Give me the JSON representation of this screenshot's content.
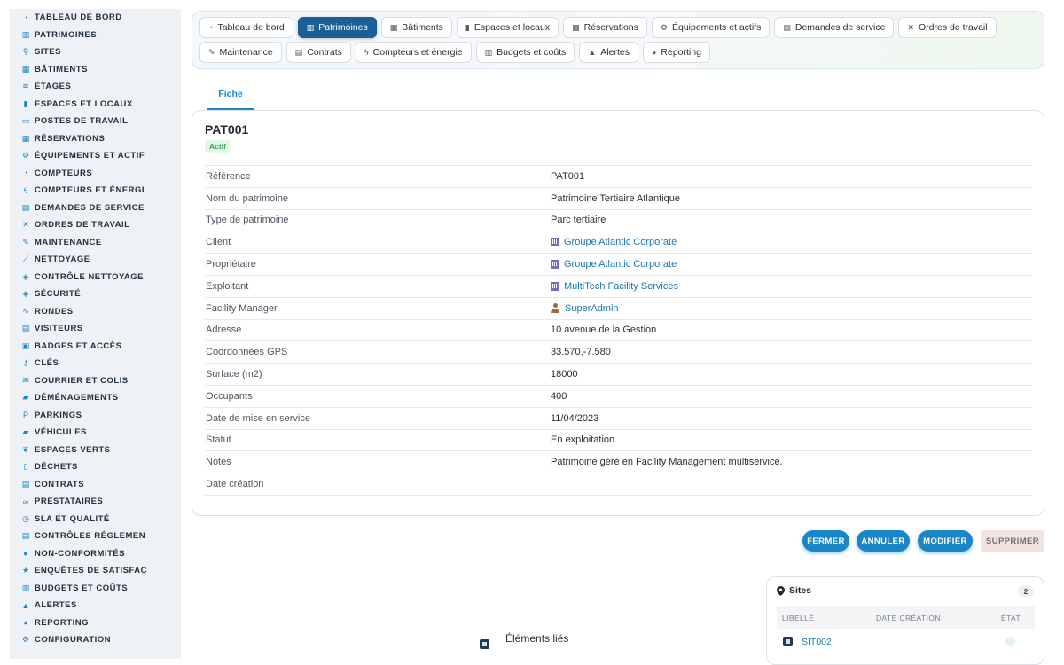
{
  "sidebar": {
    "items": [
      {
        "label": "TABLEAU DE BORD",
        "icon": "dashboard-icon"
      },
      {
        "label": "PATRIMOINES",
        "icon": "building-columns-icon"
      },
      {
        "label": "SITES",
        "icon": "map-pin-icon"
      },
      {
        "label": "BÂTIMENTS",
        "icon": "building-icon"
      },
      {
        "label": "ÉTAGES",
        "icon": "layers-icon"
      },
      {
        "label": "ESPACES ET LOCAUX",
        "icon": "door-icon"
      },
      {
        "label": "POSTES DE TRAVAIL",
        "icon": "desktop-icon"
      },
      {
        "label": "RÉSERVATIONS",
        "icon": "calendar-icon"
      },
      {
        "label": "ÉQUIPEMENTS ET ACTIF",
        "icon": "cogs-icon"
      },
      {
        "label": "COMPTEURS",
        "icon": "gauge-icon"
      },
      {
        "label": "COMPTEURS ET ÉNERGI",
        "icon": "bolt-icon"
      },
      {
        "label": "DEMANDES DE SERVICE",
        "icon": "clipboard-icon"
      },
      {
        "label": "ORDRES DE TRAVAIL",
        "icon": "tools-icon"
      },
      {
        "label": "MAINTENANCE",
        "icon": "wrench-icon"
      },
      {
        "label": "NETTOYAGE",
        "icon": "broom-icon"
      },
      {
        "label": "CONTRÔLE NETTOYAGE",
        "icon": "check-shield-icon"
      },
      {
        "label": "SÉCURITÉ",
        "icon": "shield-icon"
      },
      {
        "label": "RONDES",
        "icon": "route-icon"
      },
      {
        "label": "VISITEURS",
        "icon": "id-card-icon"
      },
      {
        "label": "BADGES ET ACCÈS",
        "icon": "badge-icon"
      },
      {
        "label": "CLÉS",
        "icon": "key-icon"
      },
      {
        "label": "COURRIER ET COLIS",
        "icon": "mail-icon"
      },
      {
        "label": "DÉMÉNAGEMENTS",
        "icon": "truck-icon"
      },
      {
        "label": "PARKINGS",
        "icon": "parking-icon"
      },
      {
        "label": "VÉHICULES",
        "icon": "car-icon"
      },
      {
        "label": "ESPACES VERTS",
        "icon": "leaf-icon"
      },
      {
        "label": "DÉCHETS",
        "icon": "trash-icon"
      },
      {
        "label": "CONTRATS",
        "icon": "file-contract-icon"
      },
      {
        "label": "PRESTATAIRES",
        "icon": "handshake-icon"
      },
      {
        "label": "SLA ET QUALITÉ",
        "icon": "stopwatch-icon"
      },
      {
        "label": "CONTRÔLES RÉGLEMEN",
        "icon": "clipboard-check-icon"
      },
      {
        "label": "NON-CONFORMITÉS",
        "icon": "alert-circle-icon"
      },
      {
        "label": "ENQUÊTES DE SATISFAC",
        "icon": "star-icon"
      },
      {
        "label": "BUDGETS ET COÛTS",
        "icon": "money-icon"
      },
      {
        "label": "ALERTES",
        "icon": "bell-icon"
      },
      {
        "label": "REPORTING",
        "icon": "chart-pie-icon"
      },
      {
        "label": "CONFIGURATION",
        "icon": "gear-icon"
      }
    ]
  },
  "nav": {
    "row1": [
      {
        "label": "Tableau de bord",
        "icon": "dashboard-icon",
        "active": false
      },
      {
        "label": "Patrimoines",
        "icon": "building-columns-icon",
        "active": true
      },
      {
        "label": "Bâtiments",
        "icon": "building-icon",
        "active": false
      },
      {
        "label": "Espaces et locaux",
        "icon": "door-icon",
        "active": false
      },
      {
        "label": "Réservations",
        "icon": "calendar-icon",
        "active": false
      },
      {
        "label": "Équipements et actifs",
        "icon": "cogs-icon",
        "active": false
      },
      {
        "label": "Demandes de service",
        "icon": "clipboard-icon",
        "active": false
      },
      {
        "label": "Ordres de travail",
        "icon": "tools-icon",
        "active": false
      }
    ],
    "row2": [
      {
        "label": "Maintenance",
        "icon": "wrench-icon",
        "active": false
      },
      {
        "label": "Contrats",
        "icon": "file-contract-icon",
        "active": false
      },
      {
        "label": "Compteurs et énergie",
        "icon": "bolt-icon",
        "active": false
      },
      {
        "label": "Budgets et coûts",
        "icon": "money-icon",
        "active": false
      },
      {
        "label": "Alertes",
        "icon": "bell-icon",
        "active": false
      },
      {
        "label": "Reporting",
        "icon": "chart-pie-icon",
        "active": false
      }
    ]
  },
  "tab": {
    "label": "Fiche"
  },
  "record": {
    "code": "PAT001",
    "status_badge": "Actif",
    "fields": [
      {
        "label": "Référence",
        "value": "PAT001",
        "link": false,
        "icon": ""
      },
      {
        "label": "Nom du patrimoine",
        "value": "Patrimoine Tertiaire Atlantique",
        "link": false,
        "icon": ""
      },
      {
        "label": "Type de patrimoine",
        "value": "Parc tertiaire",
        "link": false,
        "icon": ""
      },
      {
        "label": "Client",
        "value": "Groupe Atlantic Corporate",
        "link": true,
        "icon": "building-icon"
      },
      {
        "label": "Propriétaire",
        "value": "Groupe Atlantic Corporate",
        "link": true,
        "icon": "building-icon"
      },
      {
        "label": "Exploitant",
        "value": "MultiTech Facility Services",
        "link": true,
        "icon": "building-icon"
      },
      {
        "label": "Facility Manager",
        "value": "SuperAdmin",
        "link": true,
        "icon": "user-icon"
      },
      {
        "label": "Adresse",
        "value": "10 avenue de la Gestion",
        "link": false,
        "icon": ""
      },
      {
        "label": "Coordonnées GPS",
        "value": "33.570,-7.580",
        "link": false,
        "icon": ""
      },
      {
        "label": "Surface (m2)",
        "value": "18000",
        "link": false,
        "icon": ""
      },
      {
        "label": "Occupants",
        "value": "400",
        "link": false,
        "icon": ""
      },
      {
        "label": "Date de mise en service",
        "value": "11/04/2023",
        "link": false,
        "icon": ""
      },
      {
        "label": "Statut",
        "value": "En exploitation",
        "link": false,
        "icon": ""
      },
      {
        "label": "Notes",
        "value": "Patrimoine géré en Facility Management multiservice.",
        "link": false,
        "icon": ""
      },
      {
        "label": "Date création",
        "value": "",
        "link": false,
        "icon": ""
      }
    ]
  },
  "actions": {
    "close": "FERMER",
    "cancel": "ANNULER",
    "edit": "MODIFIER",
    "delete": "SUPPRIMER"
  },
  "linked": {
    "title": "Éléments liés"
  },
  "sites_panel": {
    "title": "Sites",
    "count": "2",
    "columns": [
      "LIBELLÉ",
      "DATE CRÉATION",
      "ÉTAT"
    ],
    "rows": [
      {
        "code": "SIT002",
        "date": ""
      }
    ]
  },
  "colors": {
    "accent": "#1a86c8",
    "active_nav": "#1a5f95",
    "badge_green": "#2fa352",
    "link": "#1a75b5"
  }
}
